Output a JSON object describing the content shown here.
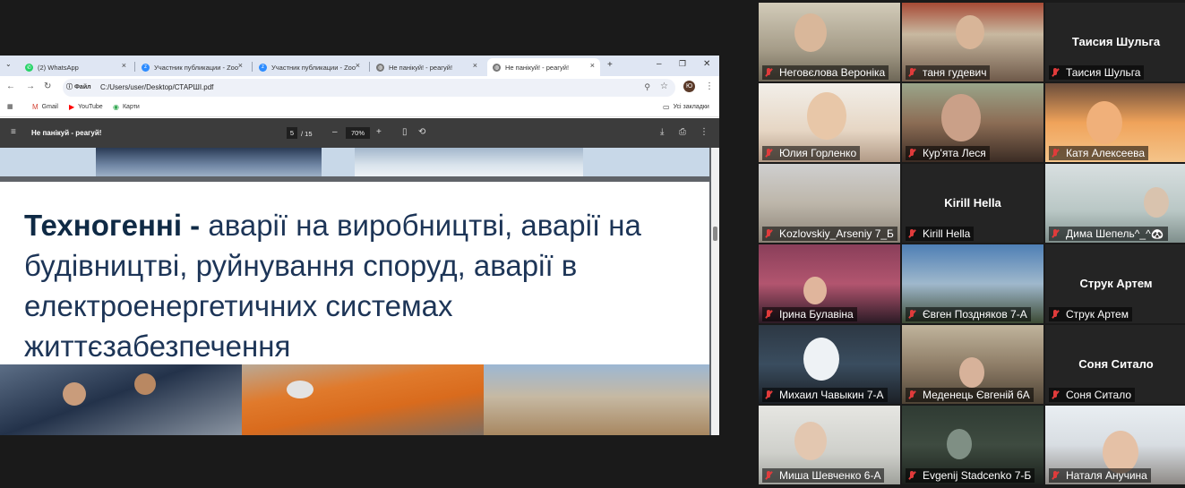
{
  "browser": {
    "tabs": [
      {
        "label": "(2) WhatsApp",
        "icon": "whatsapp-icon"
      },
      {
        "label": "Участник публикации - Zoo",
        "icon": "zoom-icon"
      },
      {
        "label": "Участник публикации - Zoo",
        "icon": "zoom-icon"
      },
      {
        "label": "Не панікуй! - реагуй!",
        "icon": "globe-icon"
      },
      {
        "label": "Не панікуй! - реагуй!",
        "icon": "globe-icon"
      }
    ],
    "address": {
      "chip": "Файл",
      "url": "C:/Users/user/Desktop/СТАРШІ.pdf"
    },
    "bookmarks": [
      {
        "label": "Gmail",
        "icon": "gmail-icon"
      },
      {
        "label": "YouTube",
        "icon": "youtube-icon"
      },
      {
        "label": "Карти",
        "icon": "maps-icon"
      }
    ],
    "all_bookmarks": "Усі закладки",
    "profile_initial": "Ю"
  },
  "pdf": {
    "title": "Не панікуй - реагуй!",
    "page": "5",
    "total": "/ 15",
    "zoom": "70%",
    "slide_heading": "Техногенні -",
    "slide_body": " аварії на виробництві, аварії на будівництві, руйнування споруд, аварії в електроенергетичних системах життєзабезпечення"
  },
  "participants": [
    {
      "name": "Неговєлова Вероніка",
      "video": true
    },
    {
      "name": "таня гудевич",
      "video": true
    },
    {
      "name": "Таисия Шульга",
      "video": false
    },
    {
      "name": "Юлия Горленко",
      "video": true,
      "speaking": true
    },
    {
      "name": "Кур'ята Леся",
      "video": true
    },
    {
      "name": "Катя Алексеева",
      "video": true
    },
    {
      "name": "Kozlovskiy_Arseniy 7_Б",
      "video": true
    },
    {
      "name": "Kirill Hella",
      "video": false
    },
    {
      "name": "Дима Шепель^_^🐼",
      "video": true
    },
    {
      "name": "Ірина Булавіна",
      "video": true
    },
    {
      "name": "Євген Поздняков 7-А",
      "video": true
    },
    {
      "name": "Струк Артем",
      "video": false
    },
    {
      "name": "Михаил Чавыкин 7-А",
      "video": true
    },
    {
      "name": "Меденець Євгеній 6А",
      "video": true
    },
    {
      "name": "Соня Ситало",
      "video": false
    },
    {
      "name": "Миша Шевченко 6-А",
      "video": true
    },
    {
      "name": "Evgenij Stadcenko 7-Б",
      "video": true
    },
    {
      "name": "Наталя Анучина",
      "video": true
    }
  ],
  "colors": {
    "muted_mic": "#e03b3b",
    "speaking_border": "#29c94f",
    "slide_text": "#1d3557"
  }
}
